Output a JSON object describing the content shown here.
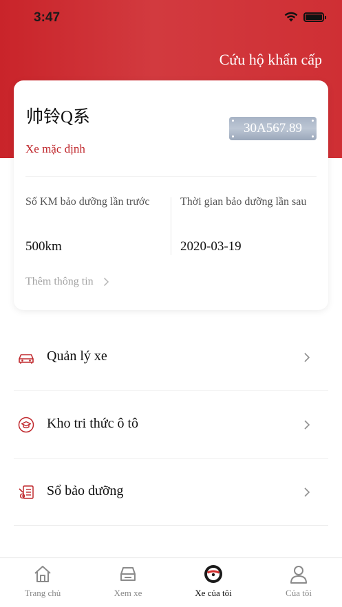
{
  "status_bar": {
    "time": "3:47"
  },
  "header": {
    "rescue_link": "Cứu hộ khẩn cấp"
  },
  "vehicle": {
    "name": "帅铃Q系",
    "plate": "30A567.89",
    "default_tag": "Xe mặc định",
    "last_service_km_label": "Số KM bảo dưỡng lần trước",
    "last_service_km_value": "500km",
    "next_service_time_label": "Thời gian bảo dưỡng lần sau",
    "next_service_time_value": "2020-03-19",
    "more_info": "Thêm thông tin"
  },
  "menu": {
    "items": [
      {
        "label": "Quản lý xe",
        "icon": "car-icon"
      },
      {
        "label": "Kho tri thức ô tô",
        "icon": "graduation-cap-icon"
      },
      {
        "label": "Sổ bảo dưỡng",
        "icon": "maintenance-book-icon"
      }
    ]
  },
  "tabbar": {
    "tabs": [
      {
        "label": "Trang chủ",
        "icon": "home-icon"
      },
      {
        "label": "Xem xe",
        "icon": "car-front-icon"
      },
      {
        "label": "Xe của tôi",
        "icon": "steering-wheel-icon",
        "active": true
      },
      {
        "label": "Của tôi",
        "icon": "person-icon"
      }
    ]
  },
  "colors": {
    "brand_red": "#c9242a",
    "plate_blue": "#a7b3c5",
    "muted_text": "#a3a3a3"
  }
}
